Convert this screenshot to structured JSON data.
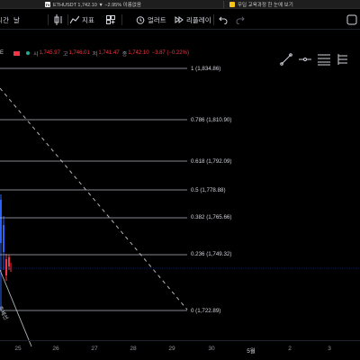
{
  "browser": {
    "tab1_label": "ETHUSDT 1,742.10 ▼ −2.95% 이름없음",
    "tab2_label": "무딥 교육과정 한 눈에 보기",
    "tab1_favicon": "TV",
    "tab2_favicon_color": "#f5c518"
  },
  "toolbar": {
    "interval_label": "4시간",
    "interval_suffix": "날",
    "indicators_label": "지표",
    "alert_label": "얼러트",
    "replay_label": "리플레이"
  },
  "legend": {
    "symbol_tail": "E",
    "open_label": "시",
    "open_value": "1,745.97",
    "high_label": "고",
    "high_value": "1,746.01",
    "low_label": "저",
    "low_value": "1,741.47",
    "close_label": "종",
    "close_value": "1,742.10",
    "change": "−3.87 (−0.22%)",
    "change_color": "#f23645"
  },
  "fib_levels": [
    {
      "label": "1 (1,834.86)"
    },
    {
      "label": "0.786 (1,810.90)"
    },
    {
      "label": "0.618 (1,792.09)"
    },
    {
      "label": "0.5 (1,778.88)"
    },
    {
      "label": "0.382 (1,765.66)"
    },
    {
      "label": "0.236 (1,749.32)"
    },
    {
      "label": "0 (1,722.89)"
    }
  ],
  "trendline_label": "추세선",
  "x_ticks": [
    "25",
    "26",
    "27",
    "28",
    "29",
    "30",
    "5월",
    "2",
    "3"
  ],
  "colors": {
    "background": "#000000",
    "fib_line": "#b2b5be",
    "bear": "#f23645",
    "bull": "#2962ff",
    "price_line": "#2962ff"
  }
}
